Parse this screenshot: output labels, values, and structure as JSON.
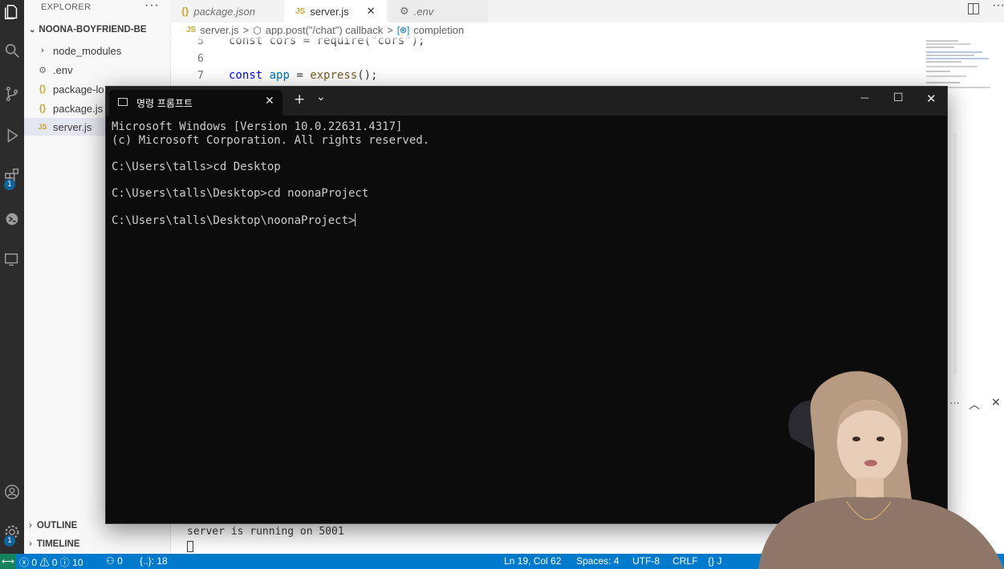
{
  "explorer": {
    "title": "EXPLORER",
    "more": "···",
    "project": "NOONA-BOYFRIEND-BE",
    "items": [
      {
        "icon": "chevron-right",
        "label": "node_modules"
      },
      {
        "icon": "gear",
        "label": ".env"
      },
      {
        "icon": "json-braces",
        "label": "package-lo"
      },
      {
        "icon": "json-braces",
        "label": "package.js"
      },
      {
        "icon": "js",
        "label": "server.js"
      }
    ],
    "outline": "OUTLINE",
    "timeline": "TIMELINE"
  },
  "activity": {
    "badge_extensions": "1",
    "badge_settings": "1"
  },
  "tabs": [
    {
      "icon": "{}",
      "label": "package.json",
      "italic": true
    },
    {
      "icon": "JS",
      "label": "server.js",
      "active": true,
      "close": "✕"
    },
    {
      "icon": "gear",
      "label": ".env",
      "italic": true
    }
  ],
  "breadcrumb": {
    "icon": "JS",
    "file": "server.js",
    "sep": ">",
    "symbol": "app.post(\"/chat\") callback",
    "item": "completion"
  },
  "editor": {
    "lines": [
      {
        "num": "5",
        "code": "const cors = require(\"cors\");"
      },
      {
        "num": "6",
        "code": ""
      },
      {
        "num": "7",
        "kw": "const",
        "var": "app",
        "eq": " = ",
        "fn": "express",
        "rest": "();"
      }
    ]
  },
  "panel": {
    "output": "server is running on 5001"
  },
  "status": {
    "errors": "0",
    "warnings": "0",
    "info": "10",
    "ports": "0",
    "braces": "{..}: 18",
    "position": "Ln 19, Col 62",
    "spaces": "Spaces: 4",
    "encoding": "UTF-8",
    "eol": "CRLF",
    "lang": "{} J"
  },
  "cmd": {
    "tab_title": "명령 프롬프트",
    "close": "✕",
    "new_tab": "+",
    "dropdown": "⌄",
    "minimize": "—",
    "maximize": "☐",
    "close_window": "✕",
    "lines": [
      "Microsoft Windows [Version 10.0.22631.4317]",
      "(c) Microsoft Corporation. All rights reserved.",
      "",
      "C:\\Users\\talls>cd Desktop",
      "",
      "C:\\Users\\talls\\Desktop>cd noonaProject",
      "",
      "C:\\Users\\talls\\Desktop\\noonaProject>"
    ]
  },
  "colors": {
    "status_bar": "#007acc",
    "terminal_bg": "#0c0c0c",
    "terminal_text": "#cccccc",
    "activity_bar": "#2c2c2c"
  }
}
